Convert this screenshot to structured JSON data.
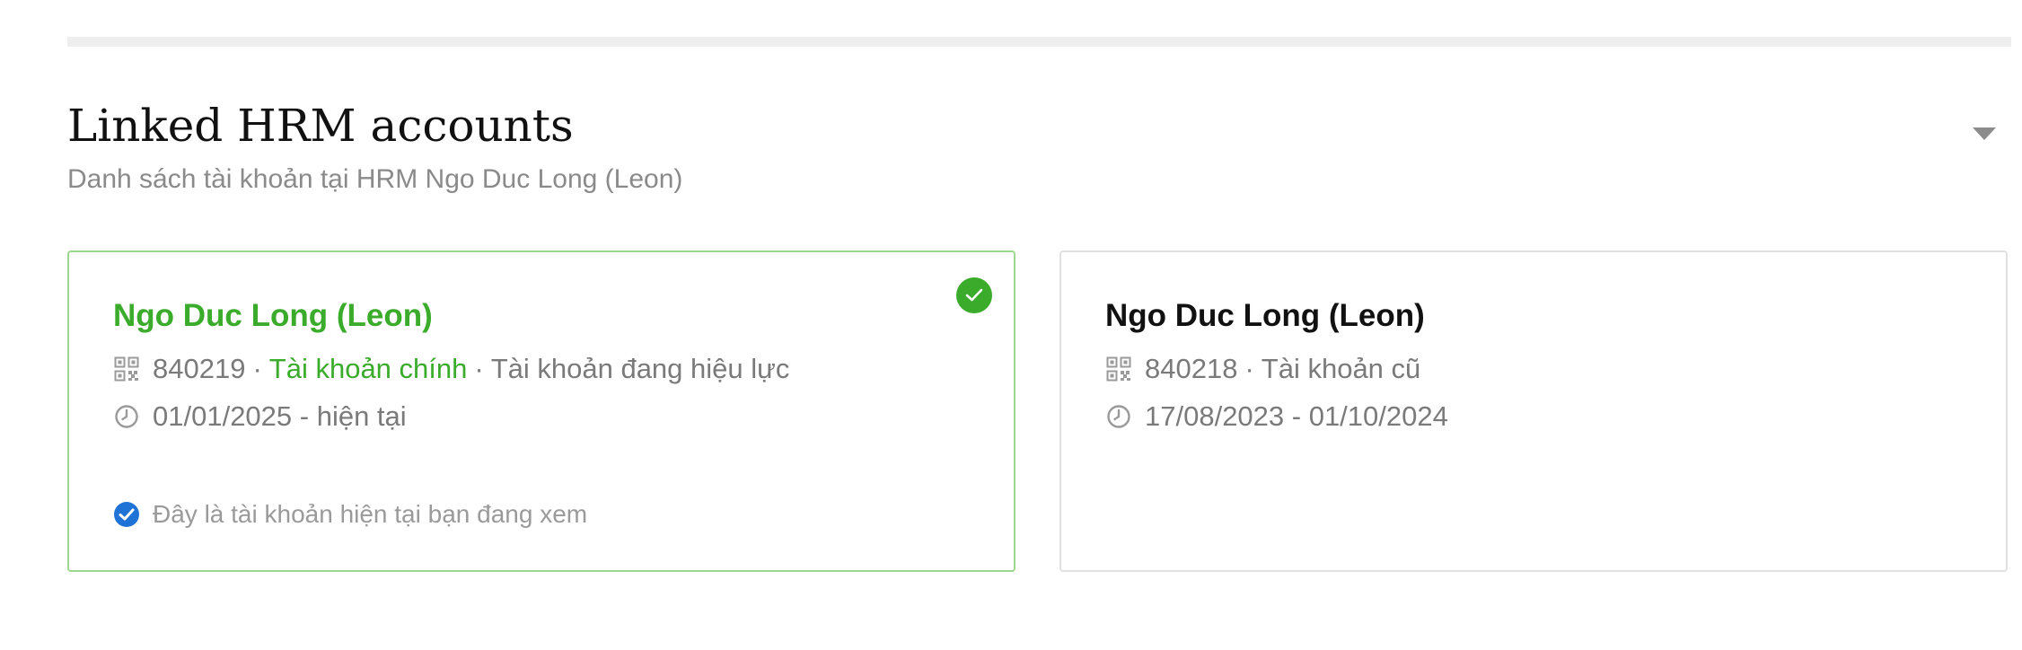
{
  "section": {
    "title": "Linked HRM accounts",
    "subtitle": "Danh sách tài khoản tại HRM Ngo Duc Long (Leon)"
  },
  "accounts": [
    {
      "name": "Ngo Duc Long (Leon)",
      "code": "840219",
      "separator": "·",
      "type_label": "Tài khoản chính",
      "status_label": "Tài khoản đang hiệu lực",
      "period": "01/01/2025 - hiện tại",
      "current_note": "Đây là tài khoản hiện tại bạn đang xem",
      "active": true
    },
    {
      "name": "Ngo Duc Long (Leon)",
      "code": "840218",
      "separator": "·",
      "type_label": "Tài khoản cũ",
      "period": "17/08/2023 - 01/10/2024",
      "active": false
    }
  ],
  "icons": {
    "account_code": "qr-code-icon",
    "period": "clock-icon",
    "selected_badge": "check-circle-icon",
    "current_note": "check-circle-icon",
    "toggle": "caret-down-icon"
  },
  "colors": {
    "accent_green": "#3aab2a",
    "active_border": "#9bd88d",
    "note_blue": "#1f73d6",
    "muted_text": "#7a7a7a",
    "divider": "#eeeeee"
  }
}
